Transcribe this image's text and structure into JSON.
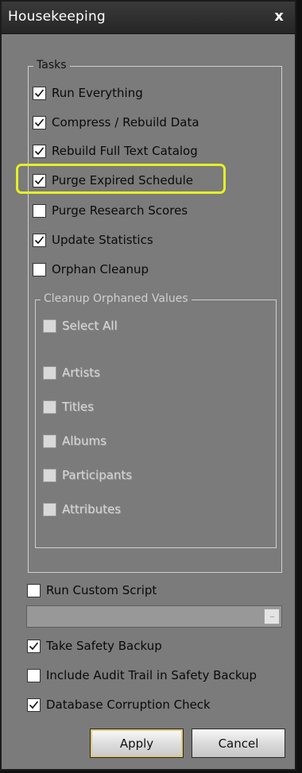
{
  "window": {
    "title": "Housekeeping",
    "close_glyph": "x"
  },
  "tasks": {
    "legend": "Tasks",
    "items": [
      {
        "label": "Run Everything",
        "checked": true
      },
      {
        "label": "Compress / Rebuild Data",
        "checked": true
      },
      {
        "label": "Rebuild Full Text Catalog",
        "checked": true
      },
      {
        "label": "Purge Expired Schedule",
        "checked": true,
        "highlighted": true
      },
      {
        "label": "Purge Research Scores",
        "checked": false
      },
      {
        "label": "Update Statistics",
        "checked": true
      },
      {
        "label": "Orphan Cleanup",
        "checked": false
      }
    ]
  },
  "cleanup": {
    "legend": "Cleanup Orphaned Values",
    "enabled": false,
    "select_all": {
      "label": "Select All",
      "checked": false
    },
    "items": [
      {
        "label": "Artists",
        "checked": false
      },
      {
        "label": "Titles",
        "checked": false
      },
      {
        "label": "Albums",
        "checked": false
      },
      {
        "label": "Participants",
        "checked": false
      },
      {
        "label": "Attributes",
        "checked": false
      }
    ]
  },
  "custom_script": {
    "label": "Run Custom Script",
    "checked": false,
    "value": "",
    "browse_label": "..."
  },
  "options": [
    {
      "label": "Take Safety Backup",
      "checked": true
    },
    {
      "label": "Include Audit Trail in Safety Backup",
      "checked": false
    },
    {
      "label": "Database Corruption Check",
      "checked": true
    }
  ],
  "buttons": {
    "apply": "Apply",
    "cancel": "Cancel"
  },
  "colors": {
    "highlight": "#e5f026",
    "dialog_bg": "#7b7b7b",
    "titlebar_bg": "#2e2e2e"
  }
}
